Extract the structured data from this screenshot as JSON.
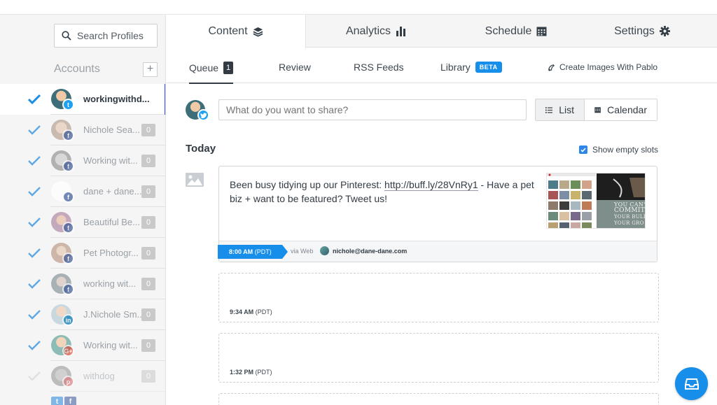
{
  "sidebar": {
    "search_placeholder": "Search Profiles",
    "accounts_label": "Accounts",
    "add_label": "+",
    "accounts": [
      {
        "name": "workingwithd...",
        "count": "",
        "network": "twitter",
        "active": true,
        "checked": true
      },
      {
        "name": "Nichole Sea...",
        "count": "0",
        "network": "facebook",
        "active": false,
        "checked": true
      },
      {
        "name": "Working wit...",
        "count": "0",
        "network": "facebook",
        "active": false,
        "checked": true
      },
      {
        "name": "dane + dane...",
        "count": "0",
        "network": "facebook",
        "active": false,
        "checked": true
      },
      {
        "name": "Beautiful Be...",
        "count": "0",
        "network": "facebook",
        "active": false,
        "checked": true
      },
      {
        "name": "Pet Photogr...",
        "count": "0",
        "network": "facebook",
        "active": false,
        "checked": true
      },
      {
        "name": "working wit...",
        "count": "0",
        "network": "facebook",
        "active": false,
        "checked": true
      },
      {
        "name": "J.Nichole Sm...",
        "count": "0",
        "network": "linkedin",
        "active": false,
        "checked": true
      },
      {
        "name": "Working wit...",
        "count": "0",
        "network": "google",
        "active": false,
        "checked": true
      },
      {
        "name": "withdog",
        "count": "0",
        "network": "pinterest",
        "active": false,
        "checked": false
      }
    ]
  },
  "top_tabs": {
    "content": "Content",
    "analytics": "Analytics",
    "schedule": "Schedule",
    "settings": "Settings"
  },
  "sub_tabs": {
    "queue": "Queue",
    "queue_count": "1",
    "review": "Review",
    "rss": "RSS Feeds",
    "library": "Library",
    "beta": "BETA",
    "pablo": "Create Images With Pablo"
  },
  "composer": {
    "placeholder": "What do you want to share?",
    "list_label": "List",
    "calendar_label": "Calendar"
  },
  "queue": {
    "day": "Today",
    "show_empty_slots": "Show empty slots",
    "post": {
      "text_before": "Been busy tidying up our Pinterest: ",
      "link": "http://buff.ly/28VnRy1",
      "text_after": " - Have a pet biz + want to be featured? Tweet us!",
      "time": "8:00 AM",
      "tz": "(PDT)",
      "via": "via Web",
      "author": "nichole@dane-dane.com"
    },
    "slots": [
      {
        "time": "9:34 AM",
        "tz": "(PDT)"
      },
      {
        "time": "1:32 PM",
        "tz": "(PDT)"
      }
    ]
  },
  "thumb_text": {
    "line1": "YOU CAN'T",
    "line2": "COMMITTE",
    "line3": "YOUR BULLS",
    "line4": "YOUR GRO"
  },
  "colors": {
    "accent": "#168eea",
    "active_bar": "#2c4bff",
    "twitter": "#1da1f2",
    "facebook": "#3b5998",
    "linkedin": "#0077b5",
    "google": "#dd4b39",
    "pinterest": "#cb2027"
  }
}
